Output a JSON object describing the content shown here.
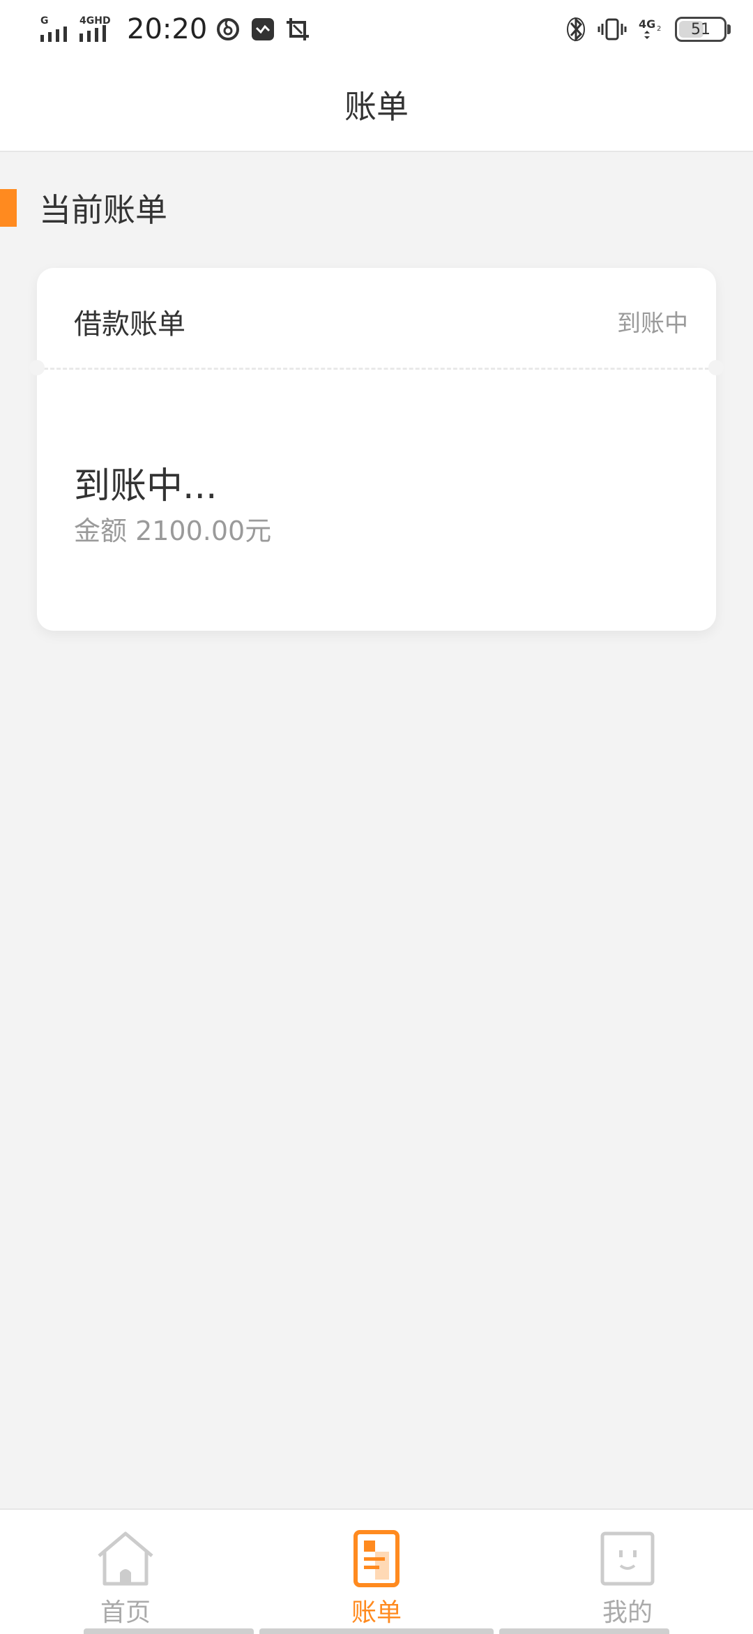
{
  "status_bar": {
    "signal_1_label": "G",
    "signal_2_label": "4GHD",
    "time": "20:20",
    "network_label": "4G",
    "battery_level": "51"
  },
  "header": {
    "title": "账单"
  },
  "section": {
    "title": "当前账单"
  },
  "bill_card": {
    "name": "借款账单",
    "status": "到账中",
    "big_status": "到账中...",
    "amount_text": "金额 2100.00元"
  },
  "bottom_nav": {
    "items": [
      {
        "label": "首页",
        "icon": "home-icon",
        "active": false
      },
      {
        "label": "账单",
        "icon": "bill-icon",
        "active": true
      },
      {
        "label": "我的",
        "icon": "profile-face-icon",
        "active": false
      }
    ]
  },
  "colors": {
    "accent": "#ff8a1f",
    "background": "#f3f3f3",
    "text_primary": "#333333",
    "text_secondary": "#9a9a9a",
    "nav_inactive": "#aaaaaa"
  }
}
